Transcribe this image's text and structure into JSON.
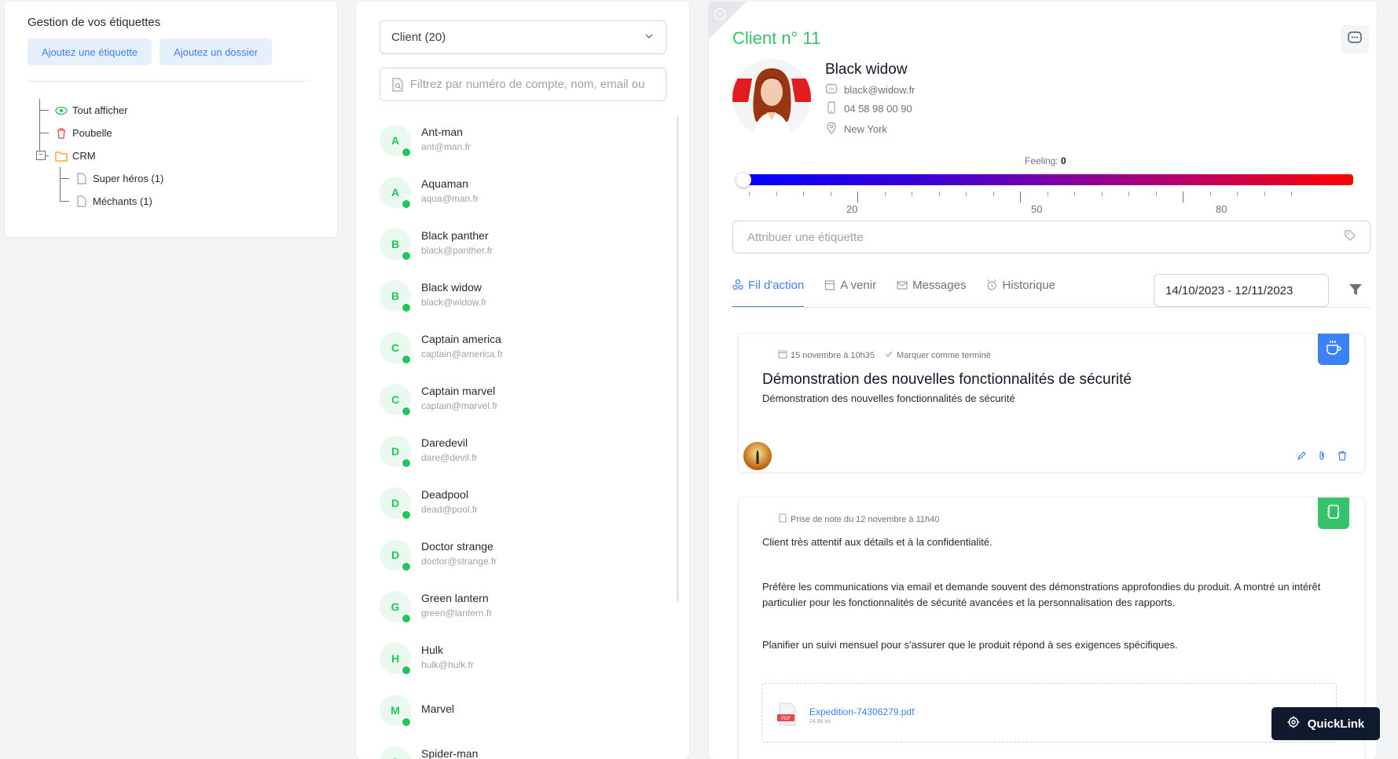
{
  "tags_panel": {
    "title": "Gestion de vos étiquettes",
    "add_tag": "Ajoutez une étiquette",
    "add_folder": "Ajoutez un dossier",
    "tree": [
      {
        "label": "Tout afficher",
        "icon": "eye-icon"
      },
      {
        "label": "Poubelle",
        "icon": "trash-icon"
      },
      {
        "label": "CRM",
        "icon": "folder-icon"
      },
      {
        "label": "Super héros (1)",
        "icon": "tag-icon"
      },
      {
        "label": "Méchants (1)",
        "icon": "tag-icon"
      }
    ]
  },
  "clients_panel": {
    "select_value": "Client (20)",
    "filter_placeholder": "Filtrez par numéro de compte, nom, email ou",
    "clients": [
      {
        "letter": "A",
        "name": "Ant-man",
        "email": "ant@man.fr"
      },
      {
        "letter": "A",
        "name": "Aquaman",
        "email": "aqua@man.fr"
      },
      {
        "letter": "B",
        "name": "Black panther",
        "email": "black@panther.fr"
      },
      {
        "letter": "B",
        "name": "Black widow",
        "email": "black@widow.fr"
      },
      {
        "letter": "C",
        "name": "Captain america",
        "email": "captain@america.fr"
      },
      {
        "letter": "C",
        "name": "Captain marvel",
        "email": "captain@marvel.fr"
      },
      {
        "letter": "D",
        "name": "Daredevil",
        "email": "dare@devil.fr"
      },
      {
        "letter": "D",
        "name": "Deadpool",
        "email": "dead@pool.fr"
      },
      {
        "letter": "D",
        "name": "Doctor strange",
        "email": "doctor@strange.fr"
      },
      {
        "letter": "G",
        "name": "Green lantern",
        "email": "green@lantern.fr"
      },
      {
        "letter": "H",
        "name": "Hulk",
        "email": "hulk@hulk.fr"
      },
      {
        "letter": "M",
        "name": "Marvel",
        "email": ""
      },
      {
        "letter": "S",
        "name": "Spider-man",
        "email": ""
      }
    ]
  },
  "detail": {
    "title": "Client n° 11",
    "name": "Black widow",
    "email": "black@widow.fr",
    "phone": "04 58 98 00 90",
    "city": "New York",
    "feeling_label": "Feeling:",
    "feeling_value": "0",
    "feeling_ticks": [
      "20",
      "50",
      "80"
    ],
    "tag_placeholder": "Attribuer une étiquette",
    "tabs": [
      "Fil d'action",
      "A venir",
      "Messages",
      "Historique"
    ],
    "date_range": "14/10/2023 - 12/11/2023",
    "colors": {
      "accent": "#3b82f6",
      "green": "#34c26b"
    }
  },
  "cards": {
    "event": {
      "date": "15 novembre à 10h35",
      "mark_done": "Marquer comme terminé",
      "title": "Démonstration des nouvelles fonctionnalités de sécurité",
      "description": "Démonstration des nouvelles fonctionnalités de sécurité"
    },
    "note": {
      "date": "Prise de note du 12 novembre à 11h40",
      "p1": "Client très attentif aux détails et à la confidentialité.",
      "p2": "Préfère les communications via email et demande souvent des démonstrations approfondies du produit. A montré un intérêt particulier pour les fonctionnalités de sécurité avancées et la personnalisation des rapports.",
      "p3": "Planifier un suivi mensuel pour s'assurer que le produit répond à ses exigences spécifiques.",
      "attachment_name": "Expedition-74306279.pdf",
      "attachment_size": "24.98 ko",
      "attachment_badge": "PDF"
    }
  },
  "quicklink": "QuickLink"
}
